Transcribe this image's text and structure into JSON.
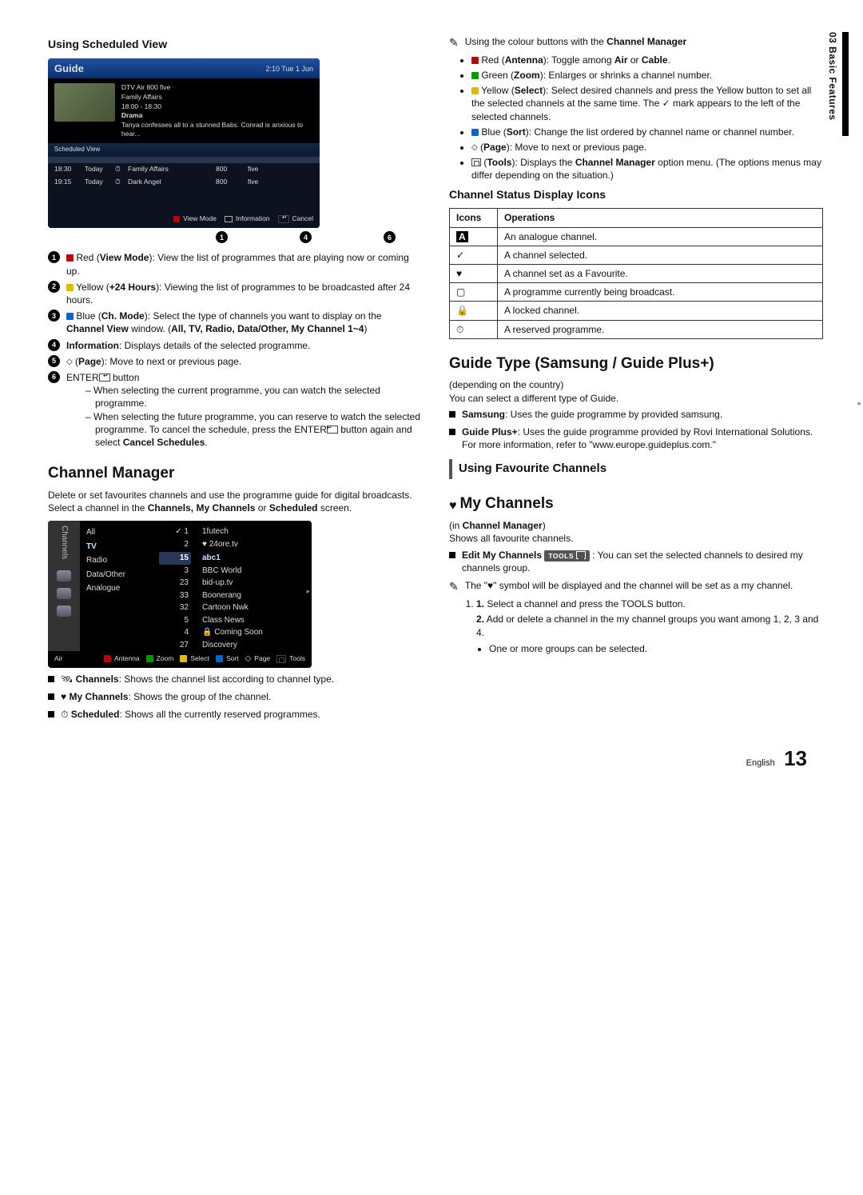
{
  "sideTab": "03  Basic Features",
  "left": {
    "heading": "Using Scheduled View",
    "guide": {
      "title": "Guide",
      "time": "2:10 Tue 1 Jun",
      "meta": {
        "line1": "DTV Air 800 five",
        "line2": "Family Affairs",
        "line3": "18:00 - 18:30",
        "line4": "Drama",
        "line5": "Tanya confesses all to a stunned Babs. Conrad is anxious to hear..."
      },
      "schedLabel": "Scheduled View",
      "rows": [
        {
          "t1": "18:30",
          "t2": "Today",
          "prog": "Family Affairs",
          "chnum": "800",
          "chname": "five"
        },
        {
          "t1": "19:15",
          "t2": "Today",
          "prog": "Dark Angel",
          "chnum": "800",
          "chname": "five"
        }
      ],
      "soft": {
        "viewMode": "View Mode",
        "info": "Information",
        "cancel": "Cancel"
      }
    },
    "callouts": {
      "a": "1",
      "b": "4",
      "c": "6"
    },
    "items": [
      {
        "num": "1",
        "pre": "Red (",
        "bold": "View Mode",
        "post": "): View the list of programmes that are playing now or coming up."
      },
      {
        "num": "2",
        "pre": "Yellow (",
        "bold": "+24 Hours",
        "post": "): Viewing the list of programmes to be broadcasted after 24 hours."
      },
      {
        "num": "3",
        "pre": "Blue (",
        "bold": "Ch. Mode",
        "post": "): Select the type of channels you want to display on the ",
        "bold2": "Channel View",
        "post2": " window. (",
        "boldlist": "All, TV, Radio, Data/Other, My Channel 1~4",
        "post3": ")"
      },
      {
        "num": "4",
        "bold": "Information",
        "post": ": Displays details of the selected programme."
      },
      {
        "num": "5",
        "pre": "(",
        "bold": "Page",
        "post": "): Move to next or previous page."
      },
      {
        "num": "6",
        "pre": "ENTER",
        "post": " button"
      }
    ],
    "dashes": [
      "When selecting the current programme, you can watch the selected programme.",
      "When selecting the future programme, you can reserve to watch the selected programme. To cancel the schedule, press the ENTER",
      " button again and select ",
      "Cancel Schedules",
      "."
    ],
    "cm": {
      "h2": "Channel Manager",
      "intro1": "Delete or set favourites channels and use the programme guide for digital broadcasts. Select a channel in the ",
      "intro_bold": "Channels, My Channels",
      "intro_or": " or ",
      "intro_bold2": "Scheduled",
      "intro_end": " screen.",
      "cat": {
        "all": "All",
        "tv": "TV",
        "radio": "Radio",
        "dataother": "Data/Other",
        "analogue": "Analogue"
      },
      "numcol": [
        "1",
        "2",
        "",
        "15",
        "3",
        "23",
        "33",
        "32",
        "5",
        "4",
        "27"
      ],
      "chancol": [
        "1futech",
        "24ore.tv",
        "",
        "abc1",
        "BBC World",
        "bid-up.tv",
        "Boonerang",
        "Cartoon Nwk",
        "Class News",
        "Coming Soon",
        "Discovery"
      ],
      "sb_left": "Air",
      "sb": {
        "ant": "Antenna",
        "zoom": "Zoom",
        "select": "Select",
        "sort": "Sort",
        "page": "Page",
        "tools": "Tools"
      },
      "sidebarLabel": "Channels"
    },
    "cmBullets": [
      {
        "bold": "Channels",
        "text": ": Shows the channel list according to channel type."
      },
      {
        "bold": "My Channels",
        "text": ": Shows the group of the channel."
      },
      {
        "bold": "Scheduled",
        "text": ": Shows all the currently reserved programmes."
      }
    ]
  },
  "right": {
    "noteIntro": "Using the colour buttons with the ",
    "noteIntroBold": "Channel Manager",
    "colorNotes": [
      {
        "c": "red",
        "label": "Red (",
        "bold": "Antenna",
        "post": "): Toggle among ",
        "bold2": "Air",
        "mid": " or ",
        "bold3": "Cable",
        "end": "."
      },
      {
        "c": "green",
        "label": "Green (",
        "bold": "Zoom",
        "post": "): Enlarges or shrinks a channel number."
      },
      {
        "c": "yellow",
        "label": "Yellow (",
        "bold": "Select",
        "post": "): Select desired channels and press the Yellow button to set all the selected channels at the same time. The ✓ mark appears to the left of the selected channels."
      },
      {
        "c": "blue",
        "label": "Blue (",
        "bold": "Sort",
        "post": "): Change the list ordered by channel name or channel number."
      },
      {
        "c": "updown",
        "label": "(",
        "bold": "Page",
        "post": "): Move to next or previous page."
      },
      {
        "c": "tool",
        "label": "(",
        "bold": "Tools",
        "post": "): Displays the ",
        "bold2": "Channel Manager",
        "end": " option menu. (The options menus may differ depending on the situation.)"
      }
    ],
    "iconsHeading": "Channel Status Display Icons",
    "tableHead": {
      "c1": "Icons",
      "c2": "Operations"
    },
    "tableRows": [
      {
        "icon": "A",
        "text": "An analogue channel."
      },
      {
        "icon": "✓",
        "text": "A channel selected."
      },
      {
        "icon": "♥",
        "text": "A channel set as a Favourite."
      },
      {
        "icon": "▢",
        "text": "A programme currently being broadcast."
      },
      {
        "icon": "🔒",
        "text": "A locked channel."
      },
      {
        "icon": "⏱",
        "text": "A reserved programme."
      }
    ],
    "guideType": {
      "h2": "Guide Type (Samsung / Guide Plus+)",
      "sub": "(depending on the country)",
      "intro": "You can select a different type of Guide.",
      "b1_bold": "Samsung",
      "b1_text": ": Uses the guide programme by provided samsung.",
      "b2_bold": "Guide Plus+",
      "b2_text": ": Uses the guide programme provided by Rovi International Solutions. For more information, refer to \"www.europe.guideplus.com.\""
    },
    "favHeading": "Using Favourite Channels",
    "myChannels": {
      "title": "My Channels",
      "sub1_pre": "(in ",
      "sub1_bold": "Channel Manager",
      "sub1_post": ")",
      "line": "Shows all favourite channels.",
      "edit_bold": "Edit My Channels",
      "toolsBadge": "TOOLS",
      "edit_text": ": You can set the selected channels to desired my channels group.",
      "note_pre": "The \"",
      "note_sym": "♥",
      "note_post": "\" symbol will be displayed and the channel will be set as a my channel.",
      "steps": [
        "Select a channel and press the TOOLS button.",
        "Add or delete a channel in the my channel groups you want among 1, 2, 3 and 4."
      ],
      "substep": "One or more groups can be selected."
    }
  },
  "footer": {
    "lang": "English",
    "num": "13"
  }
}
